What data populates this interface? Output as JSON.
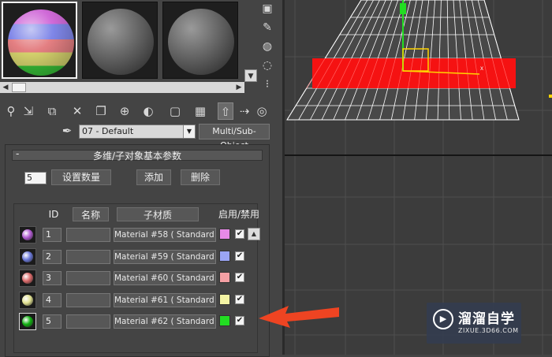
{
  "sample_slots": [
    {
      "state": "active",
      "material": "multi-color"
    },
    {
      "state": "inactive",
      "material": "grey"
    },
    {
      "state": "inactive",
      "material": "grey"
    }
  ],
  "toolbar": {
    "icons": [
      "get-material-icon",
      "put-material-icon",
      "assign-material-icon",
      "delete-icon",
      "copy-icon",
      "unique-icon",
      "material-effects-icon",
      "show-map-icon",
      "show-end-result-icon",
      "go-to-parent-icon",
      "go-forward-icon",
      "pick-material-icon"
    ]
  },
  "material_name": "07 - Default",
  "material_type": "Multi/Sub-Object",
  "rollout": {
    "title": "多维/子对象基本参数",
    "count_value": "5",
    "set_count_label": "设置数量",
    "add_label": "添加",
    "delete_label": "删除"
  },
  "table": {
    "headers": {
      "id": "ID",
      "name": "名称",
      "submaterial": "子材质",
      "enable": "启用/禁用"
    },
    "rows": [
      {
        "id": "1",
        "material": "Material #58 ( Standard )",
        "color": "#e88ae8",
        "ball": "#b05ad0",
        "enabled": true
      },
      {
        "id": "2",
        "material": "Material #59 ( Standard )",
        "color": "#9aa4f4",
        "ball": "#6a78d8",
        "enabled": true
      },
      {
        "id": "3",
        "material": "Material #60 ( Standard )",
        "color": "#f4a0a4",
        "ball": "#d86868",
        "enabled": true
      },
      {
        "id": "4",
        "material": "Material #61 ( Standard )",
        "color": "#f4f4a4",
        "ball": "#e0e090",
        "enabled": true
      },
      {
        "id": "5",
        "material": "Material #62 ( Standard )",
        "color": "#22dd22",
        "ball": "#10b010",
        "enabled": true
      }
    ]
  },
  "watermark": {
    "brand": "溜溜自学",
    "url": "ZIXUE.3D66.COM"
  },
  "colors": {
    "accent_arrow": "#ee4422",
    "selection_red": "#ff1010",
    "viewport_bg": "#3c3c3c"
  }
}
